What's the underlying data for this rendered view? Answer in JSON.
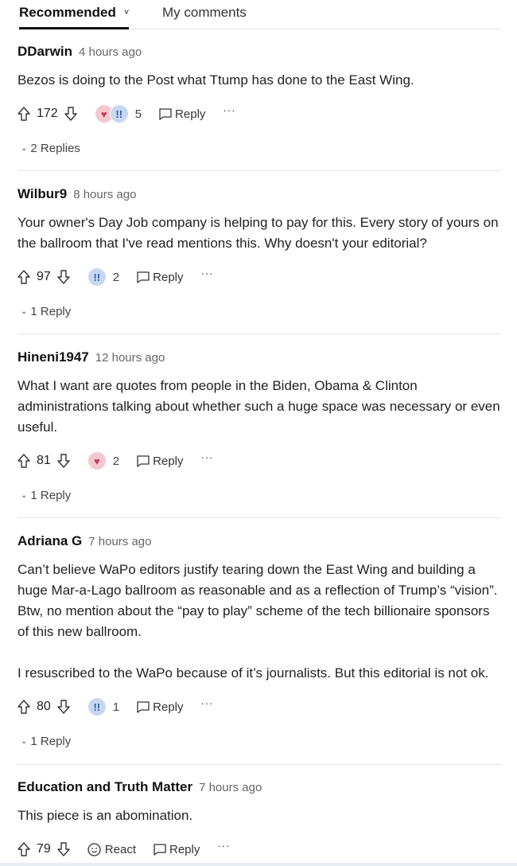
{
  "tabs": {
    "recommended": "Recommended",
    "recommended_chevron": "˅",
    "my_comments": "My comments"
  },
  "labels": {
    "reply": "Reply",
    "more": "···",
    "react": "React"
  },
  "comments": [
    {
      "author": "DDarwin",
      "time": "4 hours ago",
      "body": [
        "Bezos is doing to the Post what Ttump has done to the East Wing."
      ],
      "votes": "172",
      "reactions": [
        "heart",
        "excl"
      ],
      "reaction_count": "5",
      "replies": "2 Replies"
    },
    {
      "author": "Wilbur9",
      "time": "8 hours ago",
      "body": [
        "Your owner's Day Job company is helping to pay for this. Every story of yours on the ballroom that I've read mentions this. Why doesn't your editorial?"
      ],
      "votes": "97",
      "reactions": [
        "excl"
      ],
      "reaction_count": "2",
      "replies": "1 Reply"
    },
    {
      "author": "Hineni1947",
      "time": "12 hours ago",
      "body": [
        "What I want are quotes from people in the Biden, Obama & Clinton administrations talking about whether such a huge space was necessary or even useful."
      ],
      "votes": "81",
      "reactions": [
        "heart"
      ],
      "reaction_count": "2",
      "replies": "1 Reply"
    },
    {
      "author": "Adriana G",
      "time": "7 hours ago",
      "body": [
        "Can’t believe WaPo editors justify tearing down the East Wing and building a huge Mar-a-Lago ballroom as reasonable and as a reflection of Trump’s “vision”. Btw, no mention about the “pay to play” scheme of the tech billionaire sponsors of this new ballroom.",
        "I resuscribed to the WaPo because of it’s journalists. But this editorial is not ok."
      ],
      "votes": "80",
      "reactions": [
        "excl"
      ],
      "reaction_count": "1",
      "replies": "1 Reply"
    },
    {
      "author": "Education and Truth Matter",
      "time": "7 hours ago",
      "body": [
        "This piece is an abomination."
      ],
      "votes": "79"
    }
  ]
}
